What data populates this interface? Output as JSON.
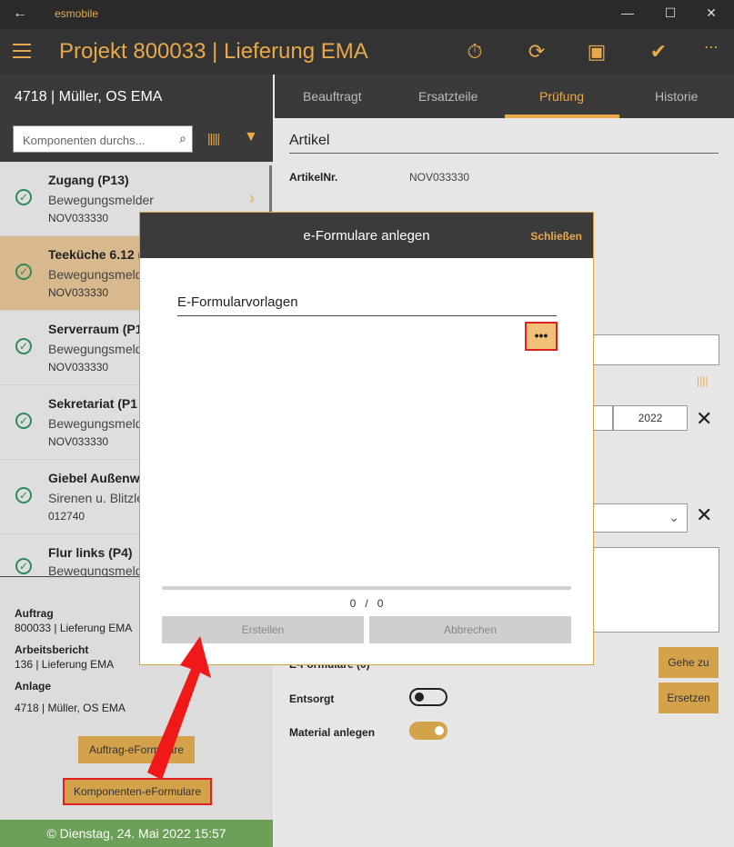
{
  "titlebar": {
    "app_name": "esmobile",
    "back": "←",
    "minimize": "—",
    "maximize": "☐",
    "close": "✕"
  },
  "header": {
    "title": "Projekt 800033  |  Lieferung EMA"
  },
  "left": {
    "anlage_title": "4718  |  Müller, OS EMA",
    "search_placeholder": "Komponenten durchs...",
    "items": [
      {
        "title": "Zugang (P13)",
        "subtitle": "Bewegungsmelder",
        "code": "NOV033330"
      },
      {
        "title": "Teeküche 6.12 (",
        "subtitle": "Bewegungsmeld",
        "code": "NOV033330"
      },
      {
        "title": "Serverraum (P1",
        "subtitle": "Bewegungsmeld",
        "code": "NOV033330"
      },
      {
        "title": "Sekretariat (P1",
        "subtitle": "Bewegungsmeld",
        "code": "NOV033330"
      },
      {
        "title": "Giebel Außenw",
        "subtitle": "Sirenen u. Blitzle",
        "code": "012740"
      },
      {
        "title": "Flur links (P4)",
        "subtitle": "Bewegungsmeld",
        "code": ""
      }
    ],
    "auftrag_label": "Auftrag",
    "auftrag_value": "800033  |  Lieferung EMA",
    "bericht_label": "Arbeitsbericht",
    "bericht_value": "136  |  Lieferung EMA",
    "anlage_label": "Anlage",
    "anlage_value": "4718  |  Müller, OS EMA",
    "dots": "•••",
    "btn_auftrag": "Auftrag-eFormulare",
    "btn_komponenten": "Komponenten-eFormulare",
    "footer": "© Dienstag, 24. Mai 2022 15:57"
  },
  "right": {
    "tabs": [
      "Beauftragt",
      "Ersatzteile",
      "Prüfung",
      "Historie"
    ],
    "section_title": "Artikel",
    "artikelnr_label": "ArtikelNr.",
    "artikelnr_value": "NOV033330",
    "year_value": "2022",
    "eformulare_label": "E-Formulare (0)",
    "btn_gehe": "Gehe zu",
    "btn_ersetzen": "Ersetzen",
    "entsorgt_label": "Entsorgt",
    "material_label": "Material anlegen",
    "toggles": {
      "entsorgt_on": false,
      "material_on": true
    }
  },
  "modal": {
    "title": "e-Formulare anlegen",
    "close": "Schließen",
    "field_label": "E-Formularvorlagen",
    "dots": "•••",
    "count_current": "0",
    "count_sep": "/",
    "count_total": "0",
    "btn_create": "Erstellen",
    "btn_cancel": "Abbrechen"
  },
  "colors": {
    "accent": "#e8a94a",
    "header_bg": "#333333",
    "footer_bg": "#6c9f57",
    "highlight_red": "#e02020"
  }
}
